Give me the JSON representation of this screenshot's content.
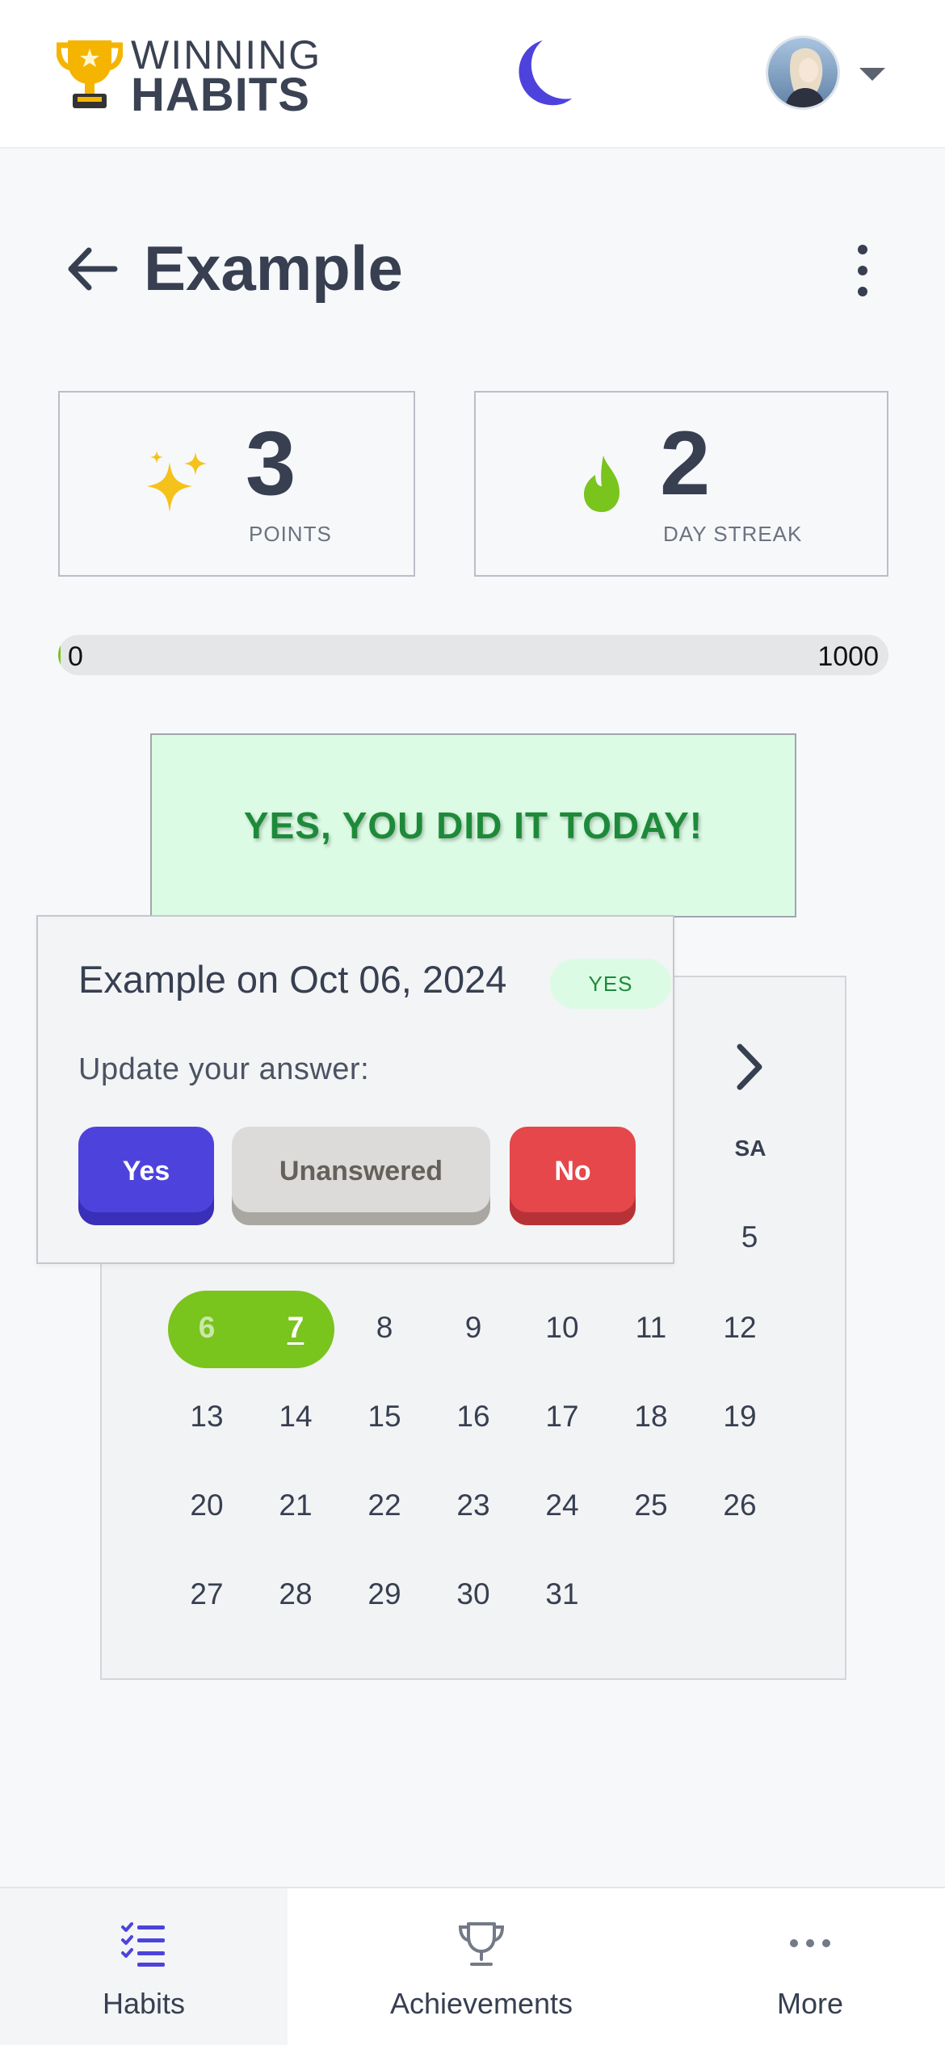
{
  "header": {
    "logo_line1": "WINNING",
    "logo_line2": "HABITS",
    "theme_icon": "moon-icon",
    "avatar_caret_icon": "caret-down-icon"
  },
  "page": {
    "title": "Example"
  },
  "stats": {
    "points_value": "3",
    "points_label": "POINTS",
    "streak_value": "2",
    "streak_label": "DAY STREAK"
  },
  "progress": {
    "min": "0",
    "max": "1000",
    "value": 3
  },
  "banner": {
    "text": "YES, YOU DID IT TODAY!"
  },
  "popover": {
    "title": "Example on Oct 06, 2024",
    "badge": "YES",
    "subtitle": "Update your answer:",
    "yes_label": "Yes",
    "unanswered_label": "Unanswered",
    "no_label": "No"
  },
  "calendar": {
    "visible_dow": "SA",
    "visible_day_5": "5",
    "weeks": [
      [
        "6",
        "7",
        "8",
        "9",
        "10",
        "11",
        "12"
      ],
      [
        "13",
        "14",
        "15",
        "16",
        "17",
        "18",
        "19"
      ],
      [
        "20",
        "21",
        "22",
        "23",
        "24",
        "25",
        "26"
      ],
      [
        "27",
        "28",
        "29",
        "30",
        "31"
      ]
    ],
    "completed_range": [
      "6",
      "7"
    ],
    "today": "7"
  },
  "nav": {
    "habits": "Habits",
    "achievements": "Achievements",
    "more": "More"
  },
  "colors": {
    "accent": "#4d43dc",
    "success": "#7ac41e",
    "danger": "#e5474b",
    "gold": "#f5b400"
  }
}
